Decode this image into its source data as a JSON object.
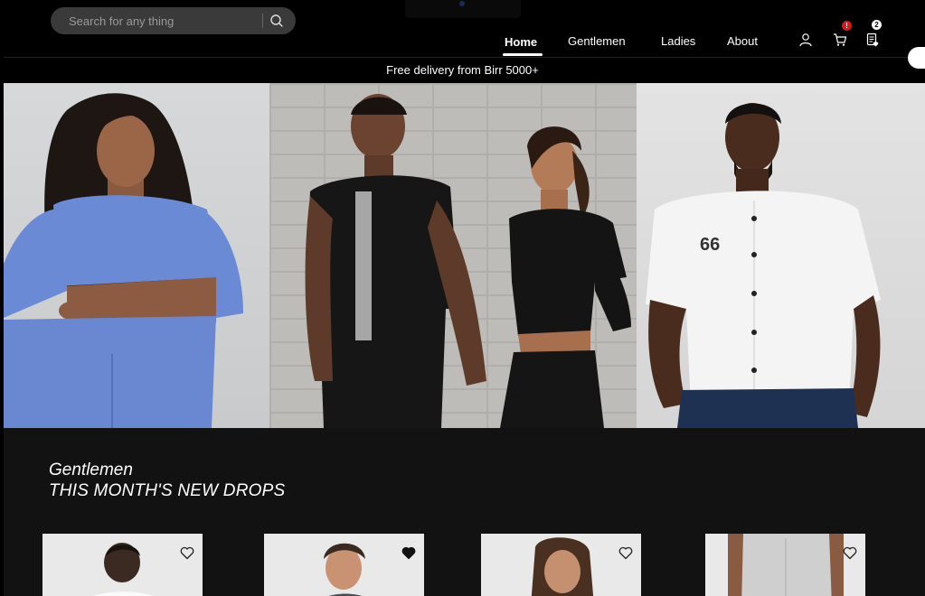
{
  "search": {
    "placeholder": "Search for any thing"
  },
  "nav": {
    "home": "Home",
    "gentlemen": "Gentlemen",
    "ladies": "Ladies",
    "about": "About"
  },
  "header_icons": {
    "account": "user-icon",
    "cart": "cart-icon",
    "wishlist": "list-icon",
    "cart_badge": "!",
    "wishlist_badge": "2"
  },
  "promo": {
    "text": "Free delivery from Birr 5000+"
  },
  "hero": {
    "panels": [
      "hero-panel-women",
      "hero-panel-couple",
      "hero-panel-man"
    ]
  },
  "section": {
    "title": "Gentlemen",
    "subtitle": "THIS MONTH'S NEW DROPS"
  },
  "products": [
    {
      "favorited": false
    },
    {
      "favorited": true
    },
    {
      "favorited": false
    },
    {
      "favorited": false
    }
  ],
  "colors": {
    "background": "#000000",
    "section_bg": "#121212",
    "badge_red": "#e01515",
    "card_bg": "#e9e9e9"
  }
}
